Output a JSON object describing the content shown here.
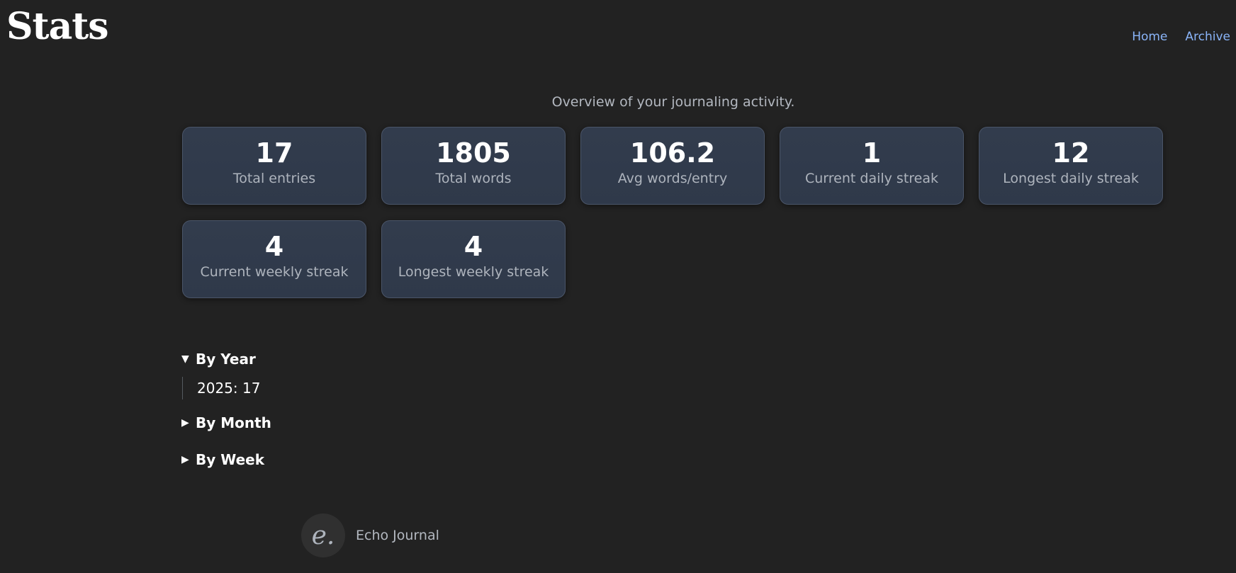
{
  "header": {
    "title": "Stats",
    "nav": [
      "Home",
      "Archive"
    ]
  },
  "subtitle": "Overview of your journaling activity.",
  "stats": [
    {
      "value": "17",
      "label": "Total entries"
    },
    {
      "value": "1805",
      "label": "Total words"
    },
    {
      "value": "106.2",
      "label": "Avg words/entry"
    },
    {
      "value": "1",
      "label": "Current daily streak"
    },
    {
      "value": "12",
      "label": "Longest daily streak"
    },
    {
      "value": "4",
      "label": "Current weekly streak"
    },
    {
      "value": "4",
      "label": "Longest weekly streak"
    }
  ],
  "sections": {
    "by_year": {
      "label": "By Year",
      "expanded": true,
      "items": [
        "2025: 17"
      ]
    },
    "by_month": {
      "label": "By Month",
      "expanded": false
    },
    "by_week": {
      "label": "By Week",
      "expanded": false
    }
  },
  "footer": {
    "logo_glyph": "e.",
    "text": "Echo Journal"
  },
  "colors": {
    "background": "#222222",
    "card": "#323c4d",
    "link": "#8ab4f8"
  }
}
